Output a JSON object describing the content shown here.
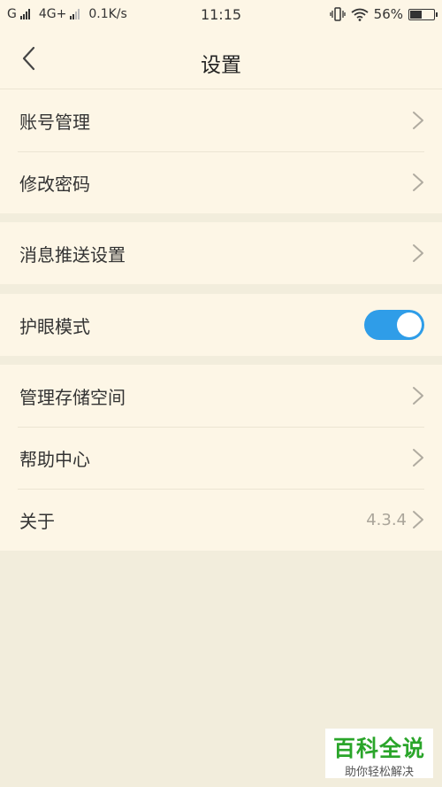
{
  "status_bar": {
    "carrier1": "G",
    "carrier2": "4G+",
    "speed": "0.1K/s",
    "time": "11:15",
    "battery_text": "56%",
    "battery_level": 0.56
  },
  "header": {
    "title": "设置"
  },
  "sections": [
    {
      "items": [
        {
          "label": "账号管理"
        },
        {
          "label": "修改密码"
        }
      ]
    },
    {
      "items": [
        {
          "label": "消息推送设置"
        }
      ]
    },
    {
      "items": [
        {
          "label": "护眼模式",
          "toggle_on": true
        }
      ]
    },
    {
      "items": [
        {
          "label": "管理存储空间"
        },
        {
          "label": "帮助中心"
        },
        {
          "label": "关于",
          "value": "4.3.4"
        }
      ]
    }
  ],
  "watermark": {
    "title": "百科全说",
    "subtitle": "助你轻松解决"
  },
  "colors": {
    "toggle_on": "#2f9de8",
    "background": "#f2eddc",
    "card": "#fdf6e6",
    "watermark_green": "#2aa52a"
  }
}
